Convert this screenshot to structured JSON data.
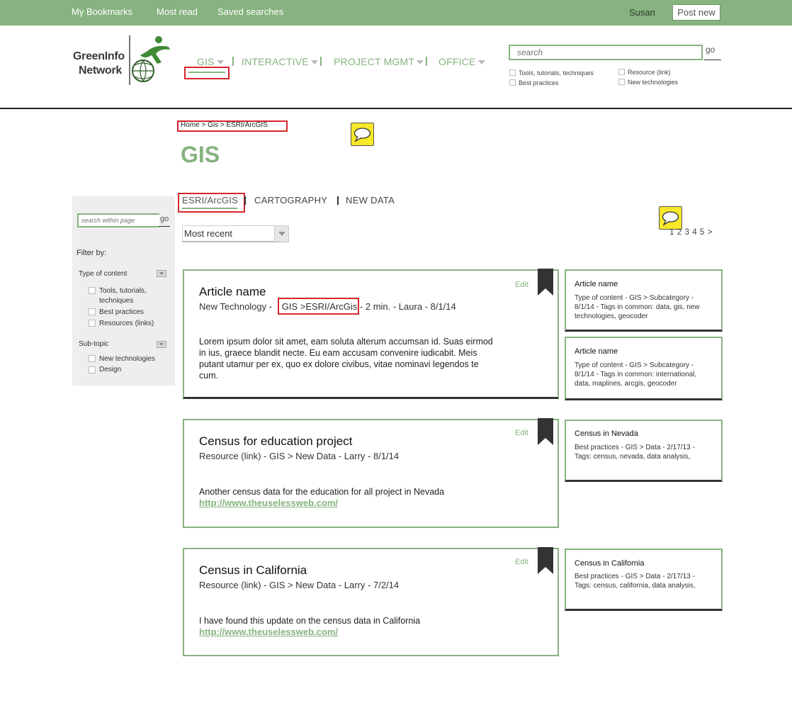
{
  "topbar": {
    "links": [
      "My Bookmarks",
      "Most read",
      "Saved searches"
    ],
    "user": "Susan",
    "post_new": "Post new"
  },
  "logo": {
    "line1": "GreenInfo",
    "line2": "Network"
  },
  "nav": {
    "items": [
      "GIS",
      "INTERACTIVE",
      "PROJECT MGMT",
      "OFFICE"
    ]
  },
  "search": {
    "placeholder": "search",
    "go": "go",
    "filters": [
      "Tools, tutorials, techniques",
      "Best practices",
      "Resource (link)",
      "New technologies"
    ]
  },
  "breadcrumb": "Home > Gis > ESRI/ArcGIS",
  "page_title": "GIS",
  "sidebar": {
    "search_placeholder": "search within page",
    "go": "go",
    "filter_by": "Filter by:",
    "type_label": "Type of content",
    "type_options": [
      "Tools, tutorials, techniques",
      "Best practices",
      "Resources (links)"
    ],
    "subtopic_label": "Sub-topic",
    "subtopic_options": [
      "New technologies",
      "Design"
    ]
  },
  "subtabs": [
    "ESRI/ArcGIS",
    "CARTOGRAPHY",
    "NEW DATA"
  ],
  "sort": {
    "selected": "Most recent"
  },
  "pagination": [
    "1",
    "2",
    "3",
    "4",
    "5",
    ">"
  ],
  "cards": [
    {
      "title": "Article name",
      "meta_before": "New Technology -",
      "meta_tag": "GIS >ESRI/ArcGis",
      "meta_after": "- 2 min.  - Laura -  8/1/14",
      "body": "Lorem ipsum dolor sit amet, eam soluta alterum accumsan id. Suas eirmod in ius, graece blandit necte. Eu eam accusam convenire iudicabit. Meis putant utamur per ex, quo ex dolore civibus, vitae nominavi legendos te cum.",
      "edit": "Edit"
    },
    {
      "title": "Census for education project",
      "meta": "Resource (link)  -  GIS > New Data -  Larry - 8/1/14",
      "body": "Another census data for the education for all project in Nevada",
      "link": "http://www.theuselessweb.com/",
      "edit": "Edit"
    },
    {
      "title": "Census in California",
      "meta": "Resource (link)  -  GIS > New Data -  Larry - 7/2/14",
      "body": "I have found this update on the census data in California",
      "link": "http://www.theuselessweb.com/",
      "edit": "Edit"
    }
  ],
  "related": [
    {
      "title": "Article name",
      "text": "Type of content  -  GIS > Subcategory  - 8/1/14 - Tags in common: data, gis, new technologies, geocoder"
    },
    {
      "title": "Article name",
      "text": "Type of content  -  GIS > Subcategory  - 8/1/14 - Tags in common: international, data, maplines, arcgis, geocoder"
    },
    {
      "title": "Census in Nevada",
      "text": "Best practices  -  GIS > Data - 2/17/13 - Tags: census, nevada, data analysis,"
    },
    {
      "title": "Census in California",
      "text": "Best practices  -  GIS > Data - 2/17/13 - Tags: census, california, data analysis,"
    }
  ],
  "colors": {
    "accent": "#86b37f",
    "annotation": "#d7262b",
    "comment": "#f7e82a"
  }
}
